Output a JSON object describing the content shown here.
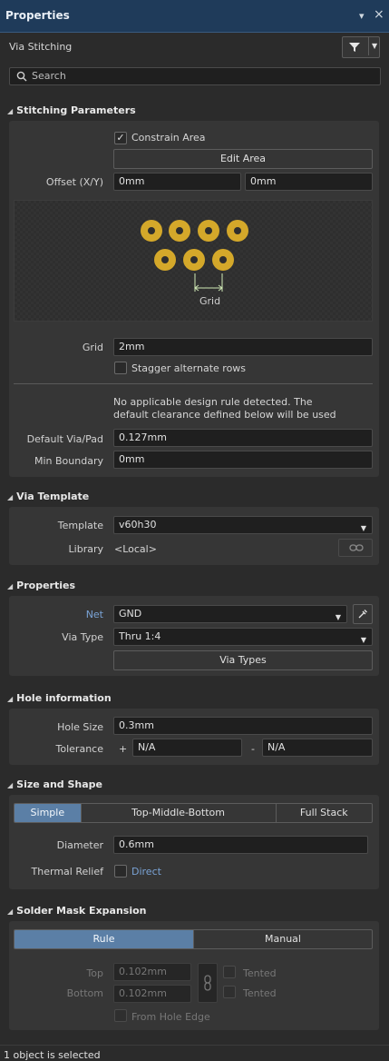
{
  "panel": {
    "title": "Properties",
    "subtitle": "Via Stitching",
    "pin_glyph": "▾",
    "close_glyph": "×",
    "filter_icon": "filter-icon"
  },
  "search": {
    "placeholder": "Search"
  },
  "stitching": {
    "header": "Stitching Parameters",
    "constrain_label": "Constrain Area",
    "constrain_checked": true,
    "edit_area_label": "Edit Area",
    "offset_label": "Offset (X/Y)",
    "offset_x": "0mm",
    "offset_y": "0mm",
    "preview_grid_label": "Grid",
    "grid_label": "Grid",
    "grid_value": "2mm",
    "stagger_label": "Stagger alternate rows",
    "stagger_checked": false,
    "note": "No applicable design rule detected. The default clearance defined below will be used",
    "default_via_label": "Default Via/Pad",
    "default_via_value": "0.127mm",
    "min_boundary_label": "Min Boundary",
    "min_boundary_value": "0mm"
  },
  "via_template": {
    "header": "Via Template",
    "template_label": "Template",
    "template_value": "v60h30",
    "library_label": "Library",
    "library_value": "<Local>"
  },
  "properties": {
    "header": "Properties",
    "net_label": "Net",
    "net_value": "GND",
    "via_type_label": "Via Type",
    "via_type_value": "Thru 1:4",
    "via_types_button": "Via Types"
  },
  "hole": {
    "header": "Hole information",
    "hole_size_label": "Hole Size",
    "hole_size_value": "0.3mm",
    "tolerance_label": "Tolerance",
    "plus_sign": "+",
    "minus_sign": "-",
    "tol_plus": "N/A",
    "tol_minus": "N/A"
  },
  "size_shape": {
    "header": "Size and Shape",
    "tabs": [
      "Simple",
      "Top-Middle-Bottom",
      "Full Stack"
    ],
    "active_tab": "Simple",
    "diameter_label": "Diameter",
    "diameter_value": "0.6mm",
    "thermal_label": "Thermal Relief",
    "thermal_value": "Direct"
  },
  "solder_mask": {
    "header": "Solder Mask Expansion",
    "tabs": [
      "Rule",
      "Manual"
    ],
    "active_tab": "Rule",
    "top_label": "Top",
    "top_value": "0.102mm",
    "bottom_label": "Bottom",
    "bottom_value": "0.102mm",
    "tented_label": "Tented",
    "from_hole_label": "From Hole Edge"
  },
  "status": {
    "text": "1 object is selected"
  },
  "colors": {
    "accent": "#5b7fa6",
    "via_ring": "#d4a82a",
    "link_blue": "#7aa3d6"
  }
}
